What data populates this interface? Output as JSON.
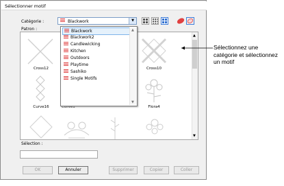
{
  "dialog": {
    "title": "Sélectionner motif"
  },
  "labels": {
    "category": "Catégorie :",
    "pattern": "Patron :",
    "selection": "Sélection :"
  },
  "category_combo": {
    "value": "Blackwork"
  },
  "dropdown": {
    "items": [
      "Blackwork",
      "Blackwork2",
      "Candlewicking",
      "Kitchen",
      "Outdoors",
      "Playtime",
      "Sashiko",
      "Single Motifs"
    ],
    "selected_index": 0
  },
  "motifs": [
    "Cross12",
    "Cross10",
    "Curve16",
    "Flora4"
  ],
  "motif_partial_label": "Curve1",
  "buttons": {
    "ok": "OK",
    "cancel": "Annuler",
    "delete": "Supprimer",
    "copy": "Copier",
    "paste": "Coller"
  },
  "callout": {
    "text": "Sélectionnez une catégorie et sélectionnez un motif"
  },
  "colors": {
    "accent": "#e04040",
    "selection_border": "#7eb4ea",
    "selection_fill": "#e5f1fb"
  },
  "icons": [
    "large-grid-icon",
    "medium-grid-icon",
    "small-grid-icon",
    "color-icon",
    "outline-icon"
  ]
}
